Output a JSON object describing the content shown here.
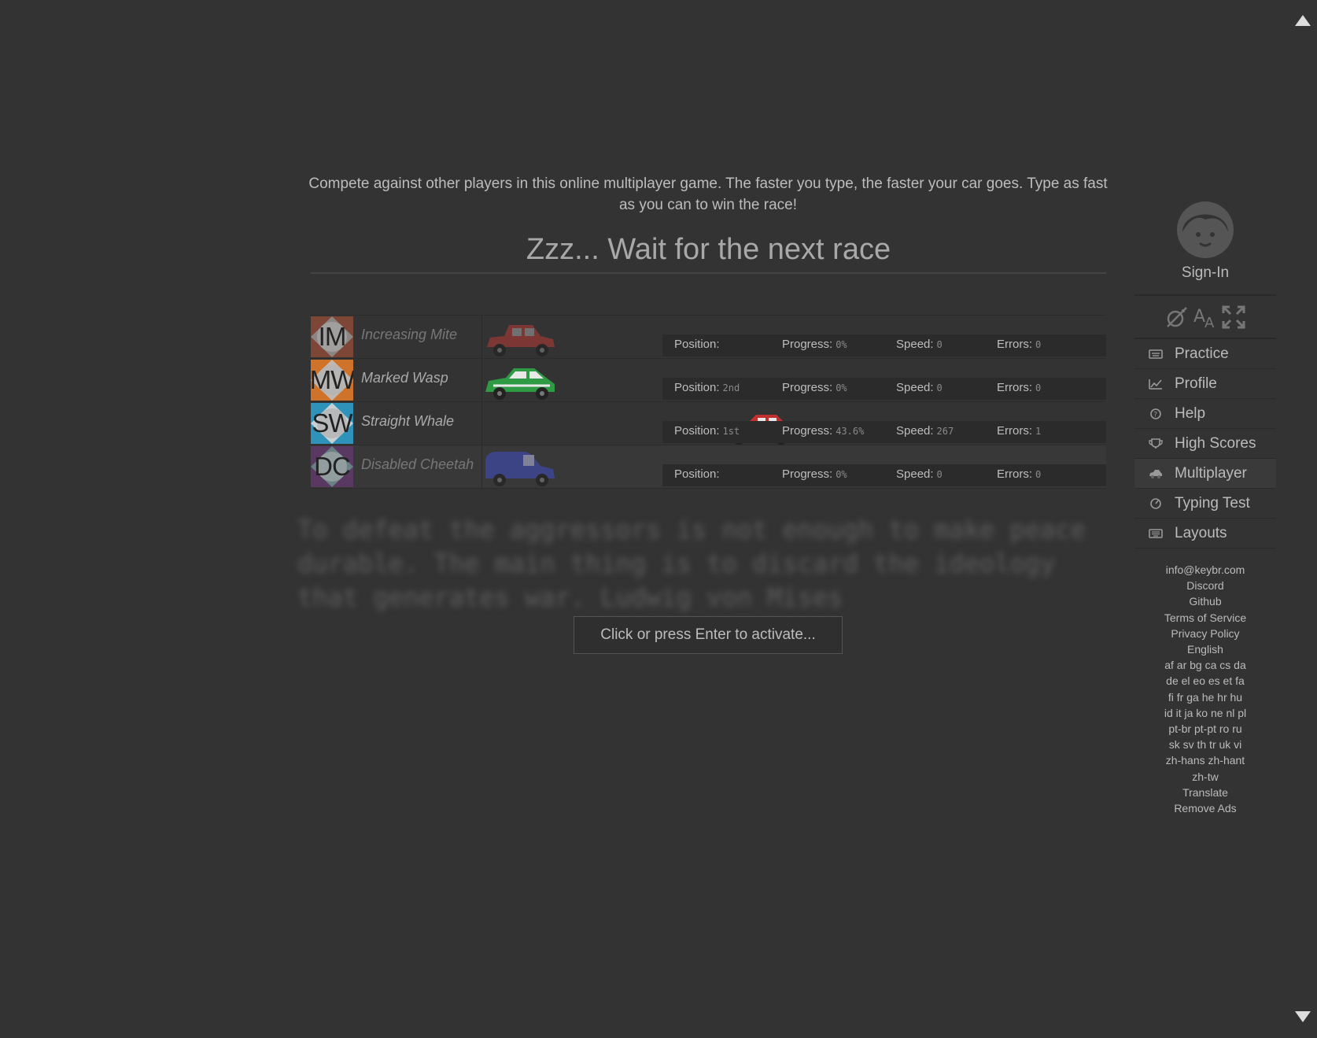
{
  "intro": "Compete against other players in this online multiplayer game. The faster you type, the faster your car goes. Type as fast as you can to win the race!",
  "title": "Zzz... Wait for the next race",
  "labels": {
    "position": "Position:",
    "progress": "Progress:",
    "speed": "Speed:",
    "errors": "Errors:"
  },
  "players": [
    {
      "initials": "IM",
      "name": "Increasing Mite",
      "position": "",
      "progress": "0%",
      "speed": "0",
      "errors": "0",
      "car_color": "#9b3a36",
      "car_type": "sedan",
      "dim": true
    },
    {
      "initials": "MW",
      "name": "Marked Wasp",
      "position": "2nd",
      "progress": "0%",
      "speed": "0",
      "errors": "0",
      "car_color": "#2e9a44",
      "car_type": "hatchback",
      "dim": false
    },
    {
      "initials": "SW",
      "name": "Straight Whale",
      "position": "1st",
      "progress": "43.6%",
      "speed": "267",
      "errors": "1",
      "car_color": "#c0302f",
      "car_type": "roadster",
      "dim": false
    },
    {
      "initials": "DC",
      "name": "Disabled Cheetah",
      "position": "",
      "progress": "0%",
      "speed": "0",
      "errors": "0",
      "car_color": "#3f4aa6",
      "car_type": "van",
      "dim": true
    }
  ],
  "quote": "To defeat the aggressors is not enough to make peace durable. The main thing is to discard the ideology that generates war. Ludwig von Mises",
  "activate_label": "Click or press Enter to activate...",
  "account": {
    "label": "Sign-In",
    "icon": "user-face-icon"
  },
  "tools": [
    {
      "icon": "theme-toggle-icon"
    },
    {
      "icon": "font-size-icon"
    },
    {
      "icon": "fullscreen-icon"
    }
  ],
  "menu": [
    {
      "label": "Practice",
      "icon": "keyboard-icon",
      "active": false
    },
    {
      "label": "Profile",
      "icon": "chart-icon",
      "active": false
    },
    {
      "label": "Help",
      "icon": "help-icon",
      "active": false
    },
    {
      "label": "High Scores",
      "icon": "trophy-icon",
      "active": false
    },
    {
      "label": "Multiplayer",
      "icon": "car-icon",
      "active": true
    },
    {
      "label": "Typing Test",
      "icon": "speedometer-icon",
      "active": false
    },
    {
      "label": "Layouts",
      "icon": "keyboard-layout-icon",
      "active": false
    }
  ],
  "links": [
    "info@keybr.com",
    "Discord",
    "Github",
    "Terms of Service",
    "Privacy Policy",
    "English",
    "af ar bg ca cs da",
    "de el eo es et fa",
    "fi fr ga he hr hu",
    "id it ja ko ne nl pl",
    "pt-br pt-pt ro ru",
    "sk sv th tr uk vi",
    "zh-hans zh-hant",
    "zh-tw",
    "Translate",
    "Remove Ads"
  ],
  "colors": {
    "background": "#333333",
    "text": "#bbbbbb"
  }
}
